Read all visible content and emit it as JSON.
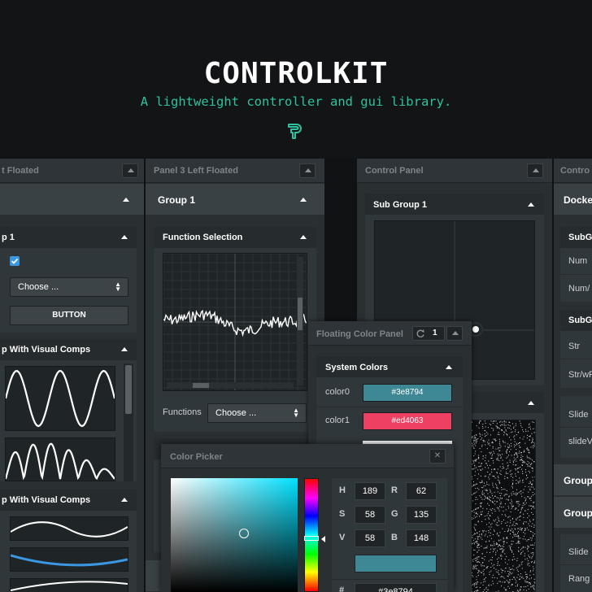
{
  "header": {
    "title": "CONTROLKIT",
    "tagline": "A lightweight controller and gui library."
  },
  "panel_left": {
    "title": "t Floated",
    "group_label": "",
    "sub1_label": "p 1",
    "select_label": "Choose ...",
    "button_label": "BUTTON",
    "sub2_label": "p With Visual Comps",
    "sub3_label": "p With Visual Comps"
  },
  "panel_three": {
    "title": "Panel 3 Left Floated",
    "group_label": "Group 1",
    "sub_label": "Function Selection",
    "functions_label": "Functions",
    "functions_select": "Choose ..."
  },
  "control_panel": {
    "title": "Control Panel",
    "sub_label": "Sub Group 1"
  },
  "panel_right": {
    "title": "Contro",
    "group_label": "Docke",
    "sub1_label": "SubG",
    "num_label": "Num",
    "numw_label": "Num/",
    "sub2_label": "SubG",
    "str_label": "Str",
    "strw_label": "Str/wF",
    "slide_label": "Slide",
    "slidev_label": "slideV",
    "group2_label": "Group",
    "group3_label": "Group",
    "slide2_label": "Slide",
    "range_label": "Rang"
  },
  "floating_color_panel": {
    "title": "Floating Color Panel",
    "counter": "1",
    "sub_label": "System Colors",
    "colors": [
      {
        "label": "color0",
        "value": "#3e8794",
        "hex": "#3e8794"
      },
      {
        "label": "color1",
        "value": "#ed4063",
        "hex": "#ed4063"
      }
    ]
  },
  "color_picker": {
    "title": "Color Picker",
    "close_symbol": "✕",
    "h_label": "H",
    "h_value": "189",
    "s_label": "S",
    "s_value": "58",
    "v_label": "V",
    "v_value": "58",
    "r_label": "R",
    "r_value": "62",
    "g_label": "G",
    "g_value": "135",
    "b_label": "B",
    "b_value": "148",
    "hash_label": "#",
    "hex_value": "#3e8794",
    "preview_color": "#3e8794"
  },
  "colors": {
    "accent": "#2ec29e",
    "background": "#111213",
    "panel": "#2a2f32"
  },
  "icons": [
    "collapse-icon",
    "checkbox-checked-icon",
    "reset-icon",
    "close-icon",
    "logo-icon"
  ]
}
